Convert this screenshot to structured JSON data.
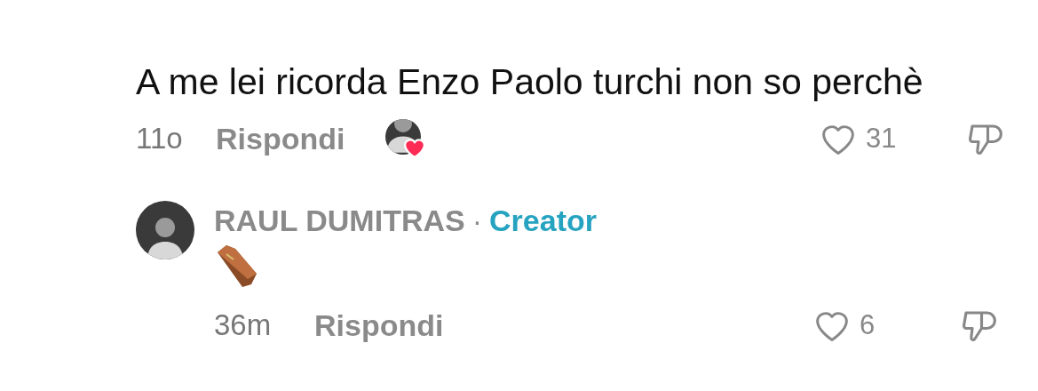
{
  "comment": {
    "text": "A me lei ricorda Enzo Paolo turchi non so perchè",
    "time": "11o",
    "reply_label": "Rispondi",
    "liked_by_creator": true,
    "liked": false,
    "likes": "31",
    "disliked": false
  },
  "reply": {
    "author": "RAUL DUMITRAS",
    "separator": "·",
    "badge": "Creator",
    "content": {
      "kind": "coffin"
    },
    "time": "36m",
    "reply_label": "Rispondi",
    "liked": false,
    "likes": "6",
    "disliked": false
  }
}
